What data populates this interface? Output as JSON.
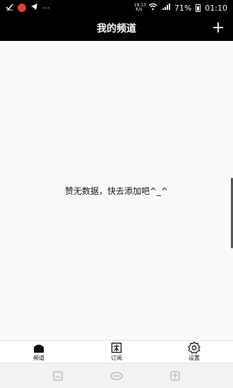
{
  "status_bar": {
    "network_speed_top": "19.13",
    "network_speed_bottom": "K/s",
    "battery_percent": "71%",
    "time": "01:10",
    "more_dots": "···"
  },
  "header": {
    "title": "我的频道",
    "add_symbol": "+"
  },
  "main": {
    "empty_message": "赞无数据，快去添加吧^_^"
  },
  "tabs": [
    {
      "label": "频道",
      "icon": "home-icon"
    },
    {
      "label": "订阅",
      "icon": "subscribe-icon"
    },
    {
      "label": "设置",
      "icon": "gear-icon"
    }
  ],
  "system_nav": {
    "buttons": [
      "recent-apps-icon",
      "home-nav-icon",
      "back-icon"
    ]
  },
  "colors": {
    "header_bg": "#000000",
    "content_bg": "#fafafa",
    "status_badge": "#d9442f"
  }
}
